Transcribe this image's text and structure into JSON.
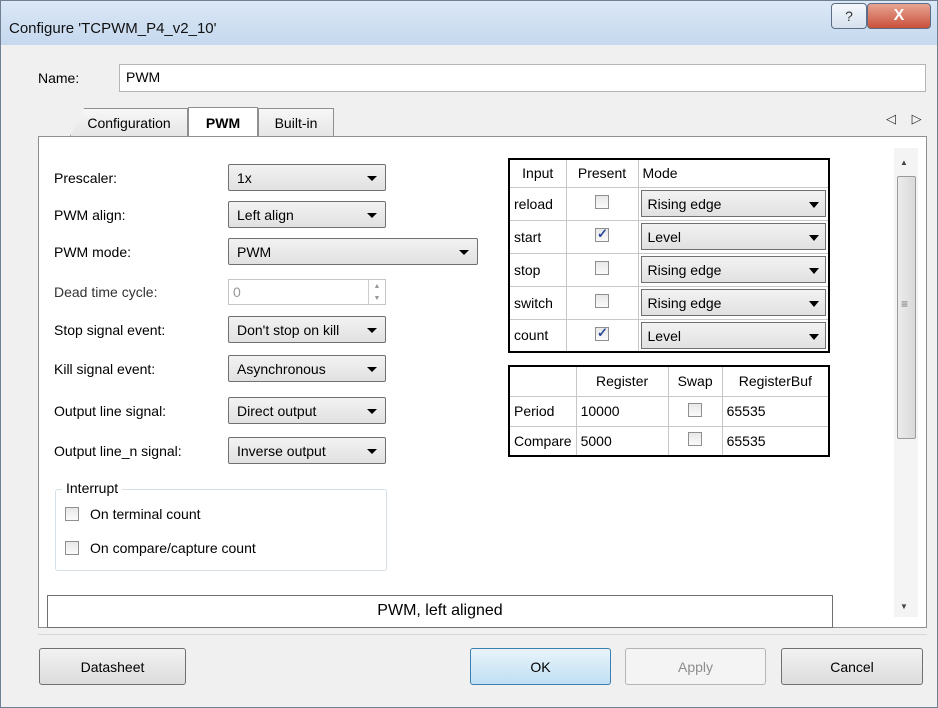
{
  "window": {
    "title": "Configure 'TCPWM_P4_v2_10'",
    "help_icon": "?",
    "close_icon": "X"
  },
  "name": {
    "label": "Name:",
    "value": "PWM"
  },
  "tabs": [
    "Configuration",
    "PWM",
    "Built-in"
  ],
  "tab_scroll": "◁ ▷",
  "fields": [
    {
      "label": "Prescaler:",
      "value": "1x"
    },
    {
      "label": "PWM align:",
      "value": "Left align"
    },
    {
      "label": "PWM mode:",
      "value": "PWM"
    },
    {
      "label": "Dead time cycle:",
      "value": "0"
    },
    {
      "label": "Stop signal event:",
      "value": "Don't stop on kill"
    },
    {
      "label": "Kill signal event:",
      "value": "Asynchronous"
    },
    {
      "label": "Output line signal:",
      "value": "Direct output"
    },
    {
      "label": "Output line_n signal:",
      "value": "Inverse output"
    }
  ],
  "interrupt": {
    "title": "Interrupt",
    "options": [
      {
        "label": "On terminal count",
        "checked": false
      },
      {
        "label": "On compare/capture count",
        "checked": false
      }
    ]
  },
  "input_table": {
    "headers": [
      "Input",
      "Present",
      "Mode"
    ],
    "rows": [
      {
        "input": "reload",
        "present": false,
        "mode": "Rising edge"
      },
      {
        "input": "start",
        "present": true,
        "mode": "Level"
      },
      {
        "input": "stop",
        "present": false,
        "mode": "Rising edge"
      },
      {
        "input": "switch",
        "present": false,
        "mode": "Rising edge"
      },
      {
        "input": "count",
        "present": true,
        "mode": "Level"
      }
    ]
  },
  "register_table": {
    "headers": [
      "",
      "Register",
      "Swap",
      "RegisterBuf"
    ],
    "rows": [
      {
        "name": "Period",
        "register": "10000",
        "swap": false,
        "buf": "65535"
      },
      {
        "name": "Compare",
        "register": "5000",
        "swap": false,
        "buf": "65535"
      }
    ]
  },
  "status_text": "PWM, left aligned",
  "buttons": {
    "datasheet": "Datasheet",
    "ok": "OK",
    "apply": "Apply",
    "cancel": "Cancel"
  }
}
